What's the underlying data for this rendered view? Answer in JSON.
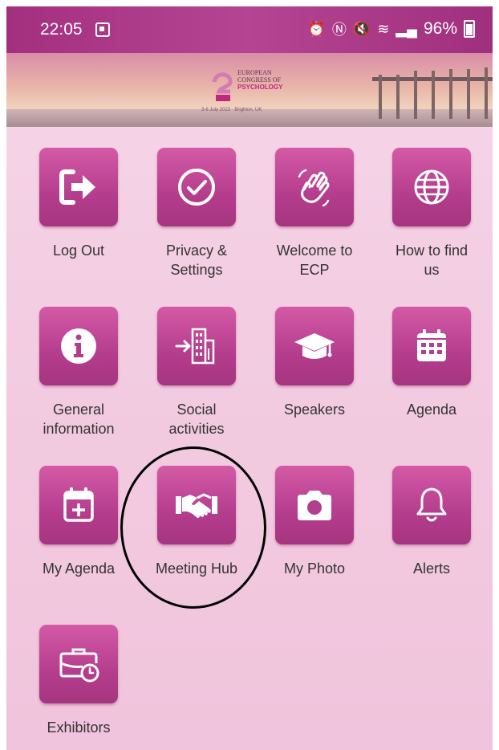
{
  "status_bar": {
    "time": "22:05",
    "battery": "96%"
  },
  "banner": {
    "logo_line1": "EUROPEAN",
    "logo_line2": "CONGRESS OF",
    "logo_line3": "PSYCHOLOGY",
    "logo_sub": "3-6 July 2023 · Brighton, UK"
  },
  "tiles": [
    {
      "label": "Log Out",
      "icon": "logout-icon"
    },
    {
      "label": "Privacy & Settings",
      "icon": "check-circle-icon"
    },
    {
      "label": "Welcome to ECP",
      "icon": "waving-hand-icon"
    },
    {
      "label": "How to find us",
      "icon": "globe-icon"
    },
    {
      "label": "General information",
      "icon": "info-icon"
    },
    {
      "label": "Social activities",
      "icon": "building-arrow-icon"
    },
    {
      "label": "Speakers",
      "icon": "graduation-cap-icon"
    },
    {
      "label": "Agenda",
      "icon": "calendar-icon"
    },
    {
      "label": "My Agenda",
      "icon": "calendar-plus-icon"
    },
    {
      "label": "Meeting Hub",
      "icon": "handshake-icon"
    },
    {
      "label": "My Photo",
      "icon": "camera-icon"
    },
    {
      "label": "Alerts",
      "icon": "bell-icon"
    },
    {
      "label": "Exhibitors",
      "icon": "briefcase-clock-icon"
    }
  ],
  "colors": {
    "accent": "#b43d8d",
    "status_bar": "#a3307f",
    "background": "#f3cde2"
  }
}
